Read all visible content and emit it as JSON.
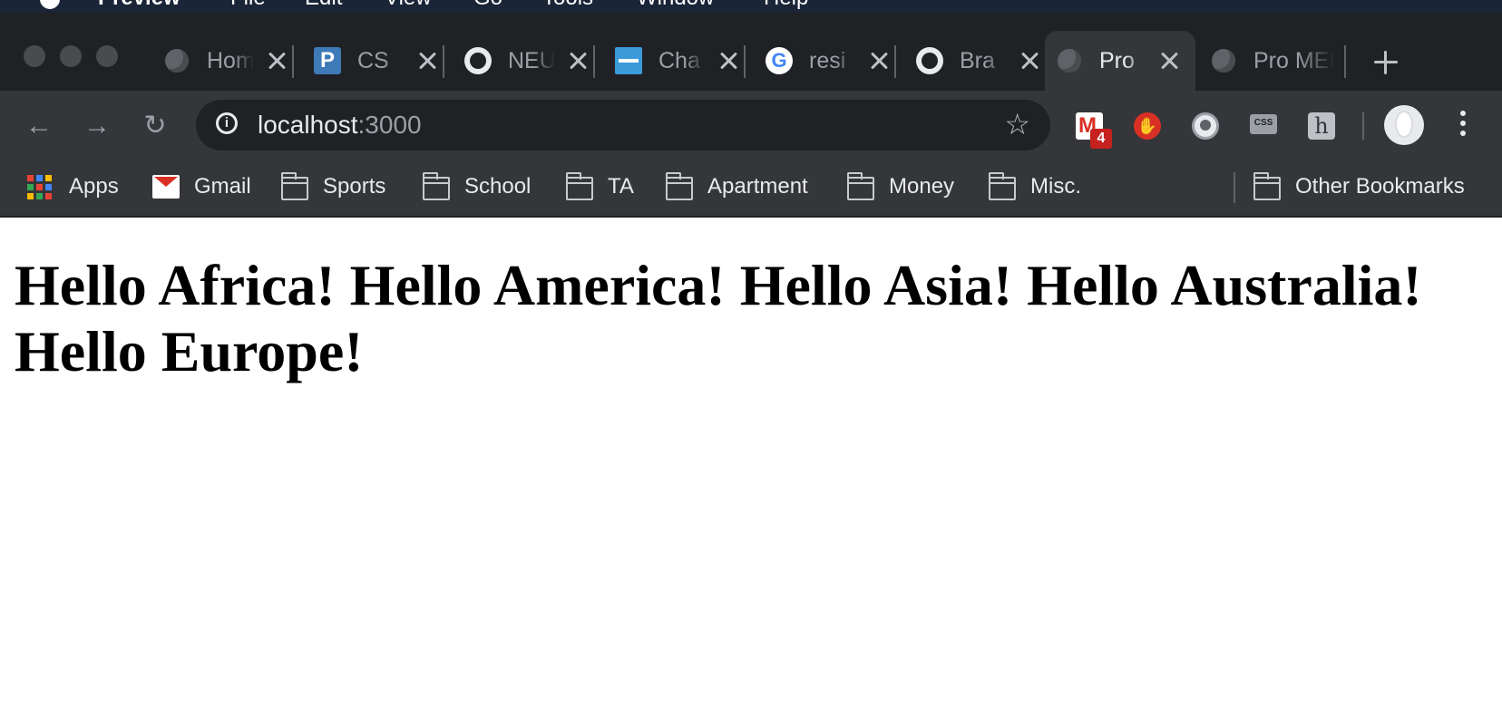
{
  "menubar": {
    "app_name": "Preview",
    "items": [
      "File",
      "Edit",
      "View",
      "Go",
      "Tools",
      "Window",
      "Help"
    ]
  },
  "tabs": [
    {
      "title": "Home",
      "icon": "globe-icon"
    },
    {
      "title": "CS",
      "icon": "piazza-icon"
    },
    {
      "title": "NEU",
      "icon": "github-icon"
    },
    {
      "title": "Cha",
      "icon": "charles-river-icon"
    },
    {
      "title": "resi",
      "icon": "google-icon"
    },
    {
      "title": "Bra",
      "icon": "github-icon"
    },
    {
      "title": "Pro",
      "icon": "globe-icon",
      "active": true
    },
    {
      "title": "Pro MEI",
      "icon": "globe-icon"
    }
  ],
  "toolbar": {
    "url_host": "localhost",
    "url_port": ":3000",
    "gmail_badge": "4"
  },
  "bookmarks": {
    "apps": "Apps",
    "gmail": "Gmail",
    "folders": [
      "Sports",
      "School",
      "TA",
      "Apartment",
      "Money",
      "Misc."
    ],
    "other": "Other Bookmarks"
  },
  "page": {
    "heading": "Hello Africa! Hello America! Hello Asia! Hello Australia! Hello Europe!"
  },
  "colors": {
    "menubar": "#1b2538",
    "tabstrip": "#202124",
    "toolbar": "#35363a",
    "page_background": "#ffffff"
  }
}
